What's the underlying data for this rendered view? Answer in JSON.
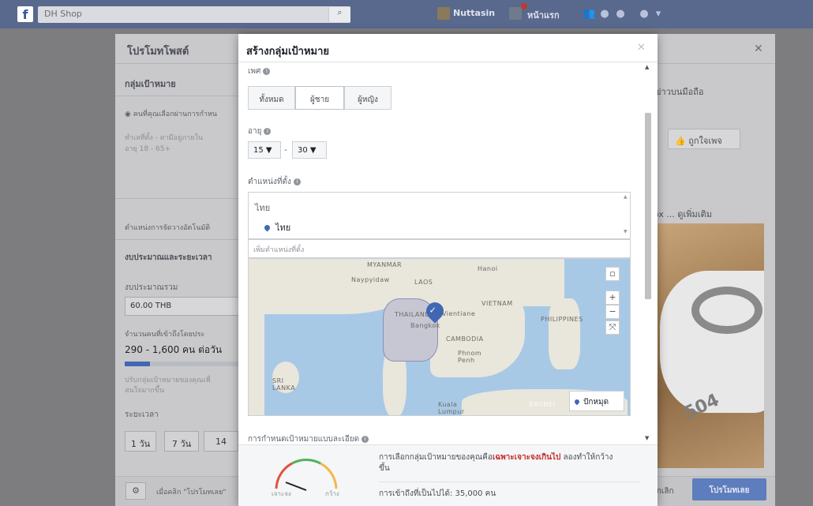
{
  "topbar": {
    "logo": "f",
    "search_value": "DH Shop",
    "search_icon": "magnifier-icon",
    "user_name": "Nuttasin",
    "home_label": "หน้าแรก"
  },
  "background_dialog": {
    "title": "โปรโมทโพสต์",
    "tab_audience": "กลุ่มเป้าหมาย",
    "tab_right": "ข่าวบนมือถือ",
    "radio_text": "คนที่คุณเลือกผ่านการกำหน",
    "audience_summary_line1": "ทำเลที่ตั้ง - ตามีอยู่ภายใน",
    "audience_summary_line2": "อายุ 18 - 65+",
    "placement_label": "ตำแหน่งการจัดวางอัตโนมัติ",
    "budget_section": "งบประมาณและระยะเวลา",
    "budget_label": "งบประมาณรวม",
    "budget_value": "60.00 THB",
    "reach_label": "จำนวนคนที่เข้าถึงโดยประ",
    "reach_value": "290 - 1,600 คน ต่อวัน",
    "reach_note_1": "ปรับกลุ่มเป้าหมายของคุณเพื่",
    "reach_note_2": "สนใจมากขึ้น",
    "duration_label": "ระยะเวลา",
    "days": [
      "1 วัน",
      "7 วัน",
      "14"
    ],
    "like_button": "ถูกใจเพจ",
    "see_more": "ดูเพิ่มเติม",
    "see_more_prefix": "ox ...",
    "footer_text": "เมื่อคลิก \"โปรโมทเลย\"",
    "cancel": "ยกเลิก",
    "promote_button": "โปรโมทเลย"
  },
  "modal": {
    "title": "สร้างกลุ่มเป้าหมาย",
    "gender_label": "เพศ",
    "gender_options": [
      "ทั้งหมด",
      "ผู้ชาย",
      "ผู้หญิง"
    ],
    "gender_selected": "ผู้ชาย",
    "age_label": "อายุ",
    "age_min": "15 ▼",
    "age_max": "30 ▼",
    "age_sep": "-",
    "location_label": "ตำแหน่งที่ตั้ง",
    "location_country_group": "ไทย",
    "location_selected": "ไทย",
    "location_placeholder": "เพิ่มตำแหน่งที่ตั้ง",
    "map_labels": {
      "myanmar": "MYANMAR",
      "naypyidaw": "Naypyidaw",
      "laos": "LAOS",
      "hanoi": "Hanoi",
      "vientiane": "Vientiane",
      "vietnam": "VIETNAM",
      "thailand": "THAILAND",
      "bangkok": "Bangkok",
      "cambodia": "CAMBODIA",
      "phnom_penh": "Phnom Penh",
      "philippines": "PHILIPPINES",
      "sri_lanka": "SRI LANKA",
      "kuala_lumpur": "Kuala Lumpur",
      "brunei": "BRUNEI"
    },
    "drop_pin": "ปักหมุด",
    "detailed_targeting_label": "การกำหนดเป้าหมายแบบละเอียด",
    "gauge_left": "เจาะจง",
    "gauge_right": "กว้าง",
    "reach_message_prefix": "การเลือกกลุ่มเป้าหมายของคุณคือ",
    "reach_message_highlight": "เฉพาะเจาะจงเกินไป",
    "reach_message_suffix": " ลองทำให้กว้างขึ้น",
    "potential_reach": "การเข้าถึงที่เป็นไปได้: 35,000 คน"
  },
  "colors": {
    "facebook_blue": "#4267b2",
    "warning_red": "#c52b2b",
    "overlay_gray": "#7d7d80"
  }
}
